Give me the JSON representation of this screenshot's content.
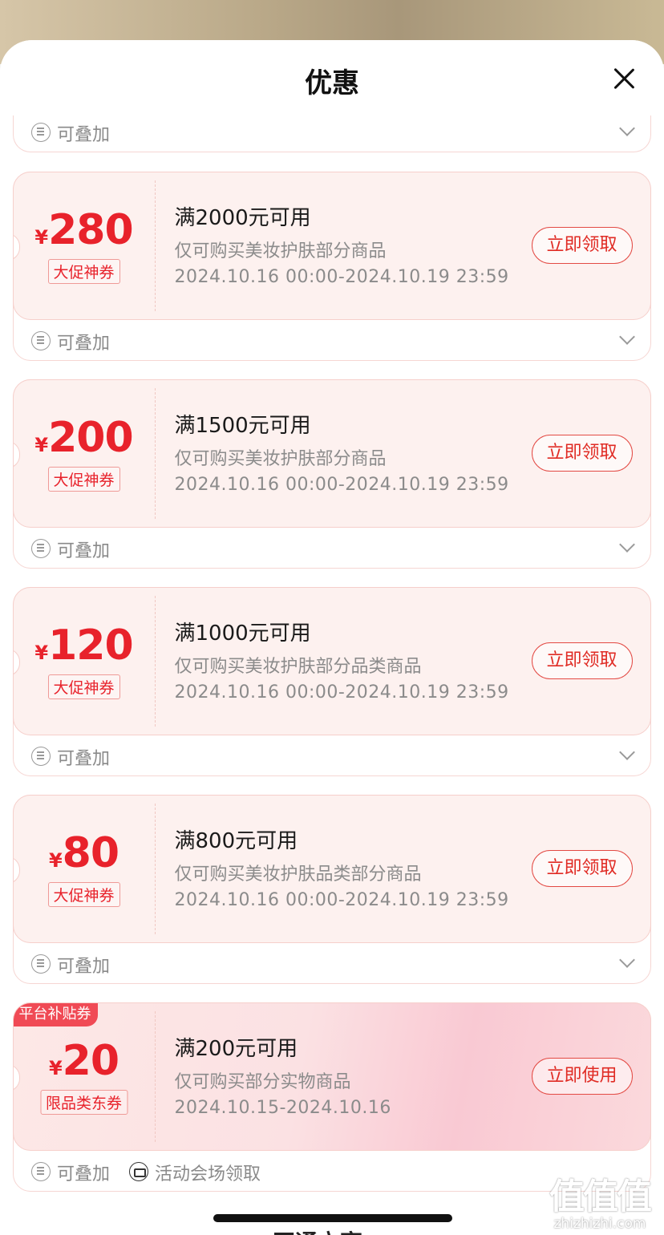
{
  "sheet": {
    "title": "优惠"
  },
  "top_partial": {
    "stack_label": "可叠加"
  },
  "coupons": [
    {
      "yen": "¥",
      "amount": "280",
      "tag": "大促神券",
      "condition": "满2000元可用",
      "scope": "仅可购买美妆护肤部分商品",
      "period": "2024.10.16 00:00-2024.10.19 23:59",
      "button": "立即领取",
      "stack_label": "可叠加"
    },
    {
      "yen": "¥",
      "amount": "200",
      "tag": "大促神券",
      "condition": "满1500元可用",
      "scope": "仅可购买美妆护肤部分商品",
      "period": "2024.10.16 00:00-2024.10.19 23:59",
      "button": "立即领取",
      "stack_label": "可叠加"
    },
    {
      "yen": "¥",
      "amount": "120",
      "tag": "大促神券",
      "condition": "满1000元可用",
      "scope": "仅可购买美妆护肤部分品类商品",
      "period": "2024.10.16 00:00-2024.10.19 23:59",
      "button": "立即领取",
      "stack_label": "可叠加"
    },
    {
      "yen": "¥",
      "amount": "80",
      "tag": "大促神券",
      "condition": "满800元可用",
      "scope": "仅可购买美妆护肤品类部分商品",
      "period": "2024.10.16 00:00-2024.10.19 23:59",
      "button": "立即领取",
      "stack_label": "可叠加"
    },
    {
      "badge": "平台补贴券",
      "yen": "¥",
      "amount": "20",
      "tag": "限品类东券",
      "condition": "满200元可用",
      "scope": "仅可购买部分实物商品",
      "period": "2024.10.15-2024.10.16",
      "button": "立即使用",
      "stack_label": "可叠加",
      "venue_label": "活动会场领取"
    }
  ],
  "bottom_peek": "开通立享",
  "watermark": {
    "glyphs": "值值值",
    "url": "zhizhizhi.com"
  },
  "icons": {
    "close": "close-icon",
    "stack": "stack-icon",
    "chevron": "chevron-down-icon",
    "venue": "ticket-icon"
  },
  "colors": {
    "accent": "#e8222b",
    "coupon_bg": "#fdf1ef",
    "badge": "#f04a55"
  }
}
